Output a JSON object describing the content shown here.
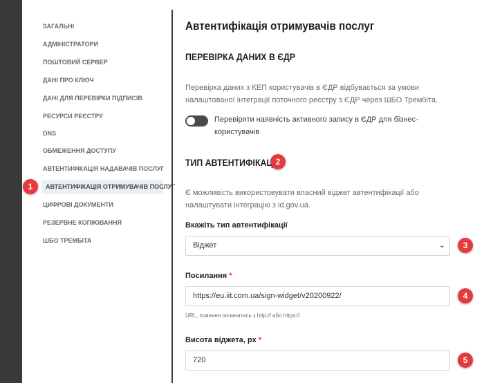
{
  "sidebar": {
    "items": [
      {
        "label": "Загальні",
        "active": false
      },
      {
        "label": "Адміністратори",
        "active": false
      },
      {
        "label": "Поштовий сервер",
        "active": false
      },
      {
        "label": "Дані про ключ",
        "active": false
      },
      {
        "label": "Дані для перевірки підписів",
        "active": false
      },
      {
        "label": "Ресурси реєстру",
        "active": false
      },
      {
        "label": "DNS",
        "active": false
      },
      {
        "label": "Обмеження доступу",
        "active": false
      },
      {
        "label": "Автентифікація надавачів послуг",
        "active": false
      },
      {
        "label": "Автентифікація отримувачів послуг",
        "active": true
      },
      {
        "label": "Цифрові документи",
        "active": false
      },
      {
        "label": "Резервне копіювання",
        "active": false
      },
      {
        "label": "ШБО Трембіта",
        "active": false
      }
    ]
  },
  "main": {
    "title": "Автентифікація отримувачів послуг",
    "edr": {
      "title": "ПЕРЕВІРКА ДАНИХ В ЄДР",
      "description": "Перевірка даних з КЕП користувачів в ЄДР відбувається за умови налаштованої інтеграції поточного реєстру з ЄДР через ШБО Трембіта.",
      "toggle_label": "Перевіряти наявність активного запису в ЄДР для бізнес-користувачів",
      "toggle_on": false
    },
    "auth": {
      "title": "ТИП АВТЕНТИФІКАЦІЇ",
      "description": "Є можливість використовувати власний віджет автентифікації або налаштувати інтеграцію з id.gov.ua.",
      "type_label": "Вкажіть тип автентифікації",
      "type_value": "Віджет",
      "link_label": "Посилання",
      "link_value": "https://eu.iit.com.ua/sign-widget/v20200922/",
      "link_hint": "URL, повинен починатись з http:// або https://",
      "height_label": "Висота віджета, px",
      "height_value": "720",
      "required_mark": "*"
    }
  },
  "markers": [
    "1",
    "2",
    "3",
    "4",
    "5"
  ],
  "colors": {
    "marker": "#e5393b",
    "active_nav_bg": "#e9f0f5",
    "left_strip": "#3a3a3a",
    "required": "#d8343d"
  }
}
